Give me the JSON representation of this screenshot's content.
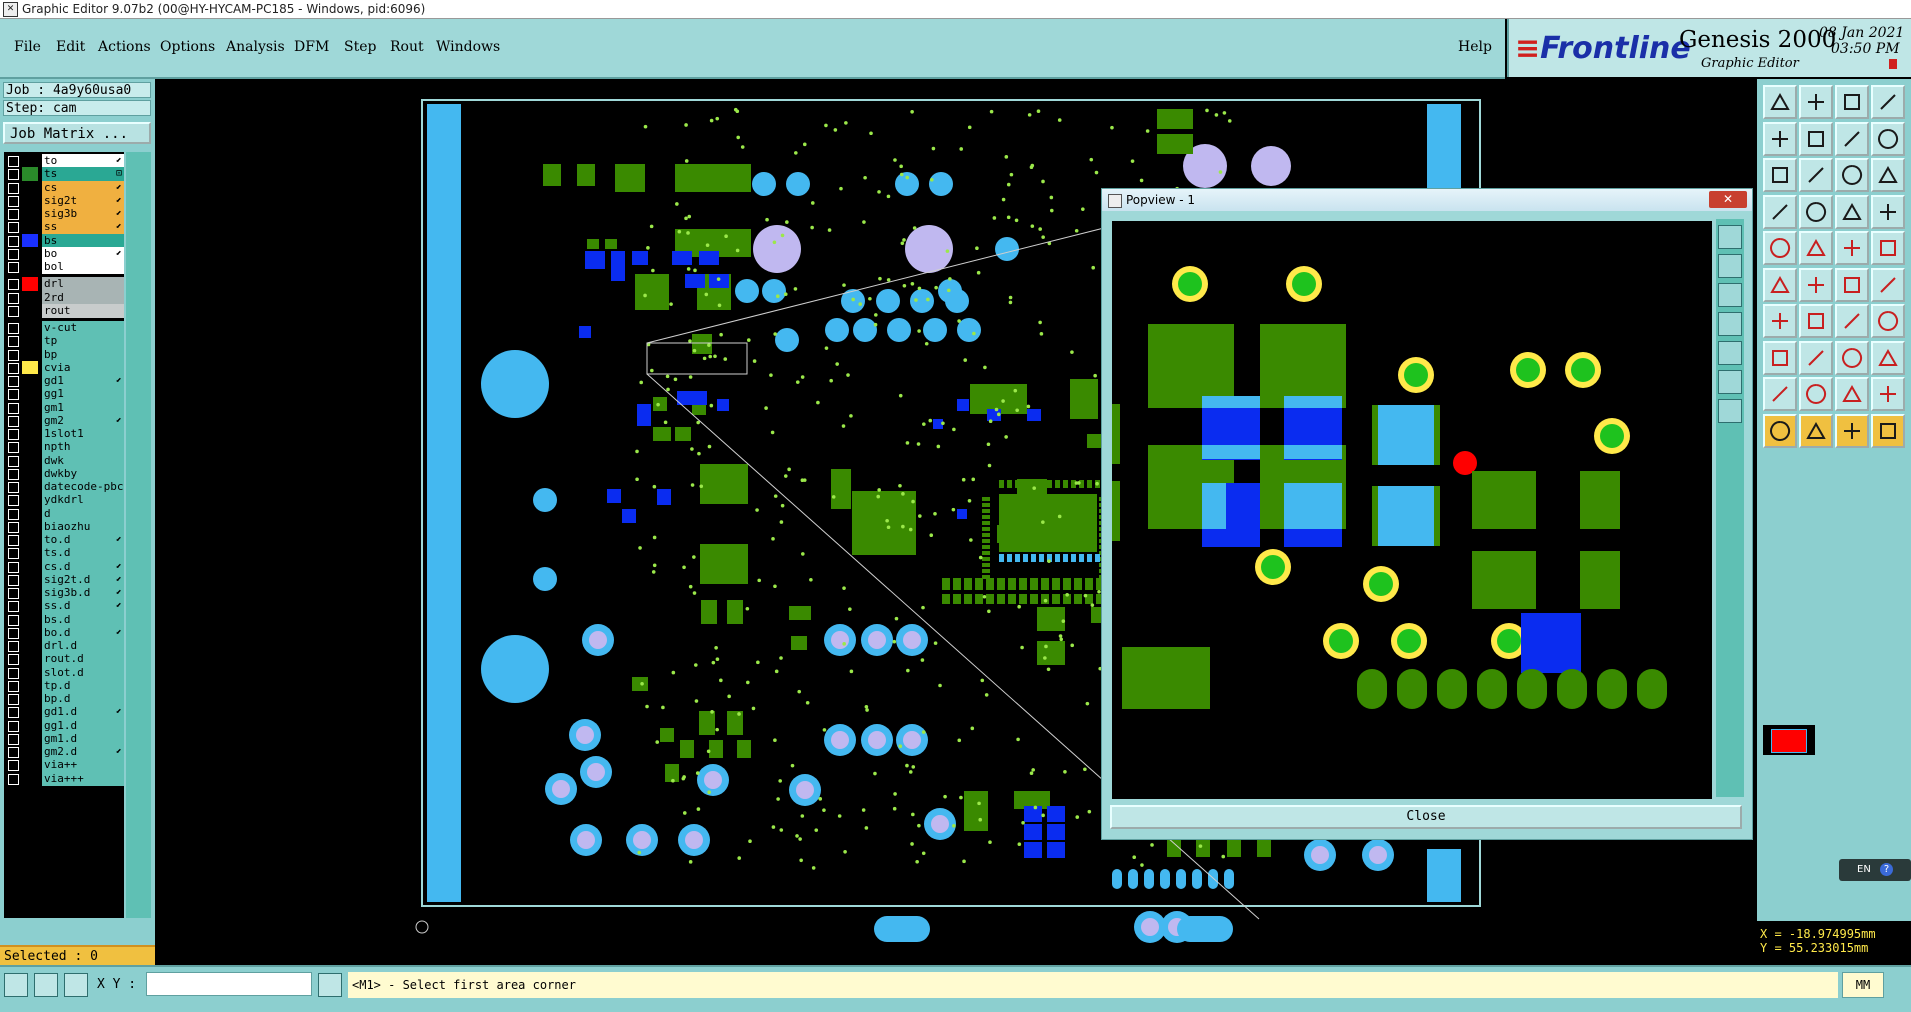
{
  "window": {
    "title": "Graphic Editor 9.07b2 (00@HY-HYCAM-PC185 - Windows, pid:6096)"
  },
  "menu": {
    "file": "File",
    "edit": "Edit",
    "actions": "Actions",
    "options": "Options",
    "analysis": "Analysis",
    "dfm": "DFM",
    "step": "Step",
    "rout": "Rout",
    "windows": "Windows",
    "help": "Help"
  },
  "logo": {
    "brand": "Frontline",
    "product": "Genesis 2000",
    "sub": "Graphic Editor",
    "date": "08 Jan 2021",
    "time": "03:50 PM"
  },
  "job": {
    "job_line": "Job : 4a9y60usa0",
    "step_line": "Step: cam",
    "matrix_button": "Job Matrix ..."
  },
  "layers": [
    {
      "name": "to",
      "bg": "#ffffff",
      "swatch": "#000000",
      "mark": "⬋"
    },
    {
      "name": "ts",
      "bg": "#2aa894",
      "swatch": "#2a8a2a",
      "mark": "⊡"
    },
    {
      "name": "cs",
      "bg": "#f0b040",
      "swatch": "#000000",
      "mark": "⬋"
    },
    {
      "name": "sig2t",
      "bg": "#f0b040",
      "swatch": "#000000",
      "mark": "⬋"
    },
    {
      "name": "sig3b",
      "bg": "#f0b040",
      "swatch": "#000000",
      "mark": "⬋"
    },
    {
      "name": "ss",
      "bg": "#f0b040",
      "swatch": "#000000",
      "mark": "⬋"
    },
    {
      "name": "bs",
      "bg": "#2aa894",
      "swatch": "#1a30ff",
      "mark": ""
    },
    {
      "name": "bo",
      "bg": "#ffffff",
      "swatch": "#000000",
      "mark": "⬋"
    },
    {
      "name": "bol",
      "bg": "#ffffff",
      "swatch": "#000000",
      "mark": ""
    },
    {
      "name": "drl",
      "bg": "#a8b4b4",
      "swatch": "#ff0000",
      "mark": ""
    },
    {
      "name": "2rd",
      "bg": "#a8b4b4",
      "swatch": "#000000",
      "mark": ""
    },
    {
      "name": "rout",
      "bg": "#c8cccc",
      "swatch": "#000000",
      "mark": ""
    },
    {
      "name": "v-cut",
      "bg": "#5fc0b4",
      "swatch": "#000000",
      "mark": ""
    },
    {
      "name": "tp",
      "bg": "#5fc0b4",
      "swatch": "#000000",
      "mark": ""
    },
    {
      "name": "bp",
      "bg": "#5fc0b4",
      "swatch": "#000000",
      "mark": ""
    },
    {
      "name": "cvia",
      "bg": "#5fc0b4",
      "swatch": "#ffe94a",
      "mark": ""
    },
    {
      "name": "gd1",
      "bg": "#5fc0b4",
      "swatch": "#000000",
      "mark": "⬋"
    },
    {
      "name": "gg1",
      "bg": "#5fc0b4",
      "swatch": "#000000",
      "mark": ""
    },
    {
      "name": "gm1",
      "bg": "#5fc0b4",
      "swatch": "#000000",
      "mark": ""
    },
    {
      "name": "gm2",
      "bg": "#5fc0b4",
      "swatch": "#000000",
      "mark": "⬋"
    },
    {
      "name": "1slot1",
      "bg": "#5fc0b4",
      "swatch": "#000000",
      "mark": ""
    },
    {
      "name": "npth",
      "bg": "#5fc0b4",
      "swatch": "#000000",
      "mark": ""
    },
    {
      "name": "dwk",
      "bg": "#5fc0b4",
      "swatch": "#000000",
      "mark": ""
    },
    {
      "name": "dwkby",
      "bg": "#5fc0b4",
      "swatch": "#000000",
      "mark": ""
    },
    {
      "name": "datecode-pbc",
      "bg": "#5fc0b4",
      "swatch": "#000000",
      "mark": ""
    },
    {
      "name": "ydkdrl",
      "bg": "#5fc0b4",
      "swatch": "#000000",
      "mark": ""
    },
    {
      "name": "d",
      "bg": "#5fc0b4",
      "swatch": "#000000",
      "mark": ""
    },
    {
      "name": "biaozhu",
      "bg": "#5fc0b4",
      "swatch": "#000000",
      "mark": ""
    },
    {
      "name": "to.d",
      "bg": "#5fc0b4",
      "swatch": "#000000",
      "mark": "⬋"
    },
    {
      "name": "ts.d",
      "bg": "#5fc0b4",
      "swatch": "#000000",
      "mark": ""
    },
    {
      "name": "cs.d",
      "bg": "#5fc0b4",
      "swatch": "#000000",
      "mark": "⬋"
    },
    {
      "name": "sig2t.d",
      "bg": "#5fc0b4",
      "swatch": "#000000",
      "mark": "⬋"
    },
    {
      "name": "sig3b.d",
      "bg": "#5fc0b4",
      "swatch": "#000000",
      "mark": "⬋"
    },
    {
      "name": "ss.d",
      "bg": "#5fc0b4",
      "swatch": "#000000",
      "mark": "⬋"
    },
    {
      "name": "bs.d",
      "bg": "#5fc0b4",
      "swatch": "#000000",
      "mark": ""
    },
    {
      "name": "bo.d",
      "bg": "#5fc0b4",
      "swatch": "#000000",
      "mark": "⬋"
    },
    {
      "name": "drl.d",
      "bg": "#5fc0b4",
      "swatch": "#000000",
      "mark": ""
    },
    {
      "name": "rout.d",
      "bg": "#5fc0b4",
      "swatch": "#000000",
      "mark": ""
    },
    {
      "name": "slot.d",
      "bg": "#5fc0b4",
      "swatch": "#000000",
      "mark": ""
    },
    {
      "name": "tp.d",
      "bg": "#5fc0b4",
      "swatch": "#000000",
      "mark": ""
    },
    {
      "name": "bp.d",
      "bg": "#5fc0b4",
      "swatch": "#000000",
      "mark": ""
    },
    {
      "name": "gd1.d",
      "bg": "#5fc0b4",
      "swatch": "#000000",
      "mark": "⬋"
    },
    {
      "name": "gg1.d",
      "bg": "#5fc0b4",
      "swatch": "#000000",
      "mark": ""
    },
    {
      "name": "gm1.d",
      "bg": "#5fc0b4",
      "swatch": "#000000",
      "mark": ""
    },
    {
      "name": "gm2.d",
      "bg": "#5fc0b4",
      "swatch": "#000000",
      "mark": "⬋"
    },
    {
      "name": "via++",
      "bg": "#5fc0b4",
      "swatch": "#000000",
      "mark": ""
    },
    {
      "name": "via+++",
      "bg": "#5fc0b4",
      "swatch": "#000000",
      "mark": ""
    }
  ],
  "selected": "Selected : 0",
  "popview": {
    "title": "Popview - 1",
    "close_button": "Close",
    "close_x": "✕"
  },
  "coords": {
    "x": "X = -18.974995mm",
    "y": "Y = 55.233015mm"
  },
  "language_bar": {
    "lang": "EN",
    "help": "?"
  },
  "bottom": {
    "xy_label": "X Y :",
    "xy_value": "",
    "prompt": "<M1> - Select first area corner",
    "units": "MM"
  },
  "colors": {
    "green": "#3a8a00",
    "blue": "#0a2cf0",
    "lightblue": "#44b8f0",
    "lilac": "#c0b8f0",
    "yellow": "#ffe94a",
    "red": "#ff0000",
    "panel": "#8ccfcf"
  }
}
